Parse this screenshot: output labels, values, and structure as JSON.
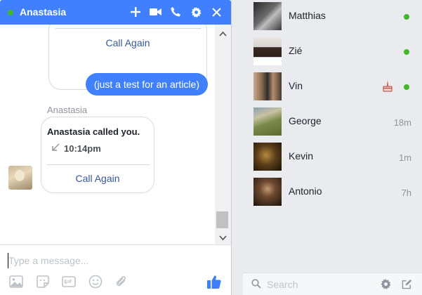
{
  "chat": {
    "title": "Anastasia",
    "header_icons": [
      "add-person-icon",
      "video-call-icon",
      "phone-icon",
      "gear-icon",
      "close-icon"
    ],
    "call_card_top": {
      "link": "Call Again"
    },
    "outgoing_message": "(just a test for an article)",
    "sender_name": "Anastasia",
    "call_card": {
      "title": "Anastasia called you.",
      "time": "10:14pm",
      "link": "Call Again"
    },
    "composer": {
      "placeholder": "Type a message...",
      "tools": [
        "photo-icon",
        "sticker-icon",
        "gif-icon",
        "emoji-icon",
        "attachment-icon",
        "like-icon"
      ]
    }
  },
  "contacts": [
    {
      "name": "Matthias",
      "status": "online",
      "last_seen": ""
    },
    {
      "name": "Zié",
      "status": "online",
      "last_seen": ""
    },
    {
      "name": "Vin",
      "status": "online",
      "last_seen": "",
      "badge": "birthday-cake-icon"
    },
    {
      "name": "George",
      "status": "offline",
      "last_seen": "18m"
    },
    {
      "name": "Kevin",
      "status": "offline",
      "last_seen": "1m"
    },
    {
      "name": "Antonio",
      "status": "offline",
      "last_seen": "7h"
    }
  ],
  "sidebar_search": {
    "placeholder": "Search"
  },
  "colors": {
    "header_blue": "#4080ff",
    "online_green": "#42b72a",
    "link_blue": "#365899",
    "muted_text": "#90949c"
  }
}
